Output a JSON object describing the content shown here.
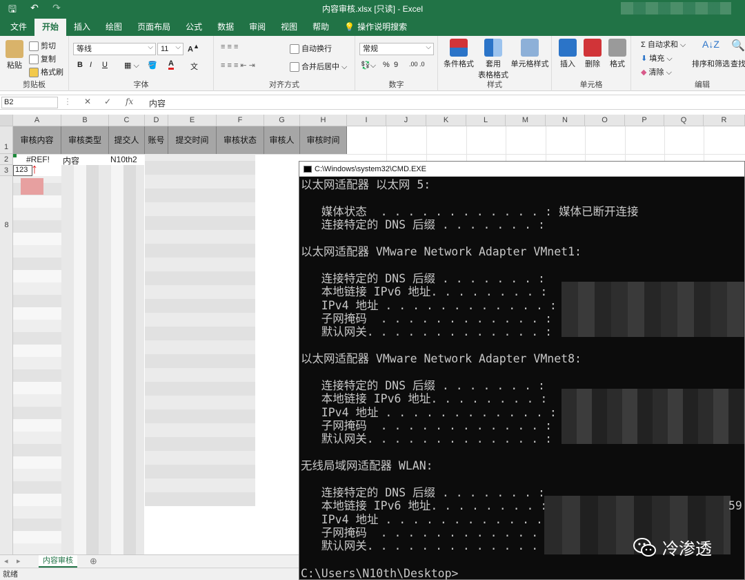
{
  "window": {
    "title": "内容审核.xlsx [只读] - Excel"
  },
  "quick_access": {
    "save_icon": "save-icon",
    "undo_icon": "undo-icon",
    "redo_icon": "redo-icon"
  },
  "ribbon_tabs": [
    "文件",
    "开始",
    "插入",
    "绘图",
    "页面布局",
    "公式",
    "数据",
    "审阅",
    "视图",
    "帮助",
    "操作说明搜索"
  ],
  "ribbon": {
    "clipboard": {
      "paste": "粘贴",
      "cut": "剪切",
      "copy": "复制",
      "format_painter": "格式刷",
      "label": "剪贴板"
    },
    "font": {
      "name": "等线",
      "size": "11",
      "bold": "B",
      "italic": "I",
      "underline": "U",
      "label": "字体"
    },
    "alignment": {
      "wrap": "自动换行",
      "merge": "合并后居中",
      "label": "对齐方式"
    },
    "number": {
      "format": "常规",
      "percent": "%",
      "comma": "9",
      "label": "数字"
    },
    "styles": {
      "conditional": "条件格式",
      "table_format_1": "套用",
      "table_format_2": "表格格式",
      "cell_styles": "单元格样式",
      "label": "样式"
    },
    "cells": {
      "insert": "插入",
      "delete": "删除",
      "format": "格式",
      "label": "单元格"
    },
    "editing": {
      "autosum": "自动求和",
      "fill": "填充",
      "clear": "清除",
      "sort": "排序和筛选",
      "find": "查找",
      "label": "编辑"
    }
  },
  "formula_bar": {
    "name_box": "B2",
    "cancel": "✕",
    "enter": "✓",
    "fx": "fx",
    "content": "内容"
  },
  "columns": [
    "A",
    "B",
    "C",
    "D",
    "E",
    "F",
    "G",
    "H",
    "I",
    "J",
    "K",
    "L",
    "M",
    "N",
    "O",
    "P",
    "Q",
    "R"
  ],
  "rows": [
    "1",
    "2",
    "3",
    "8"
  ],
  "header_row": [
    "审核内容",
    "审核类型",
    "提交人",
    "账号",
    "提交时间",
    "审核状态",
    "审核人",
    "审核时间"
  ],
  "cells": {
    "a2": "#REF!",
    "a3": "123",
    "b2": "内容",
    "c2": "N10th2"
  },
  "sheet_tab": "内容审核",
  "status": "就绪",
  "cmd": {
    "title": "C:\\Windows\\system32\\CMD.EXE",
    "lines": [
      "以太网适配器 以太网 5:",
      "",
      "   媒体状态  . . . . . . . . . . . . : 媒体已断开连接",
      "   连接特定的 DNS 后缀 . . . . . . . :",
      "",
      "以太网适配器 VMware Network Adapter VMnet1:",
      "",
      "   连接特定的 DNS 后缀 . . . . . . . :",
      "   本地链接 IPv6 地址. . . . . . . . :",
      "   IPv4 地址 . . . . . . . . . . . . :",
      "   子网掩码  . . . . . . . . . . . . :",
      "   默认网关. . . . . . . . . . . . . :",
      "",
      "以太网适配器 VMware Network Adapter VMnet8:",
      "",
      "   连接特定的 DNS 后缀 . . . . . . . :",
      "   本地链接 IPv6 地址. . . . . . . . :",
      "   IPv4 地址 . . . . . . . . . . . . :",
      "   子网掩码  . . . . . . . . . . . . :",
      "   默认网关. . . . . . . . . . . . . :",
      "",
      "无线局域网适配器 WLAN:",
      "",
      "   连接特定的 DNS 后缀 . . . . . . . :",
      "   本地链接 IPv6 地址. . . . . . . . :",
      "   IPv4 地址 . . . . . . . . . . . . :",
      "   子网掩码  . . . . . . . . . . . . :",
      "   默认网关. . . . . . . . . . . . . : 1",
      "",
      "C:\\Users\\N10th\\Desktop>"
    ],
    "tail_69": "59"
  },
  "watermark": {
    "text": "冷渗透",
    "icon": "wechat-icon"
  },
  "colors": {
    "excel_green": "#217346",
    "header_gray": "#a6a6a6",
    "cmd_bg": "#0c0c0c",
    "error_red": "#e02020"
  }
}
